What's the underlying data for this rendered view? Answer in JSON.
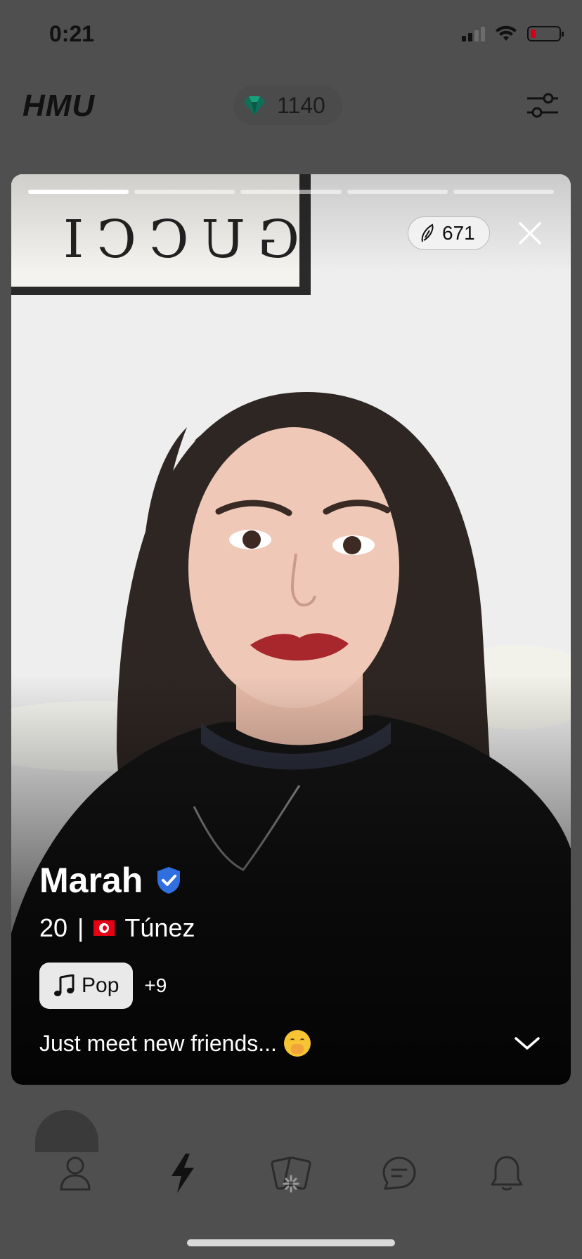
{
  "status_bar": {
    "time": "0:21"
  },
  "header": {
    "logo": "HMU",
    "gems": "1140",
    "gem_icon": "gem-icon",
    "filter_icon": "sliders-icon"
  },
  "card": {
    "progress": {
      "total": 5,
      "current": 1
    },
    "likes": "671",
    "name": "Marah",
    "verified": true,
    "age": "20",
    "separator": "|",
    "country": "Túnez",
    "country_flag": "tunisia-flag",
    "tag": {
      "label": "Pop",
      "icon": "music-note-icon"
    },
    "more_tags": "+9",
    "bio": "Just meet new friends...",
    "bio_emoji": "hand-over-mouth-emoji"
  },
  "nav": {
    "items": [
      {
        "name": "profile",
        "icon": "person-icon",
        "active": false
      },
      {
        "name": "discover",
        "icon": "lightning-icon",
        "active": true
      },
      {
        "name": "cards",
        "icon": "cards-icon",
        "active": false
      },
      {
        "name": "chat",
        "icon": "chat-icon",
        "active": false
      },
      {
        "name": "notifications",
        "icon": "bell-icon",
        "active": false
      }
    ]
  },
  "colors": {
    "overlay": "#4f4f4f",
    "verified": "#2f6fe0",
    "gem": "#0f8f6f"
  }
}
